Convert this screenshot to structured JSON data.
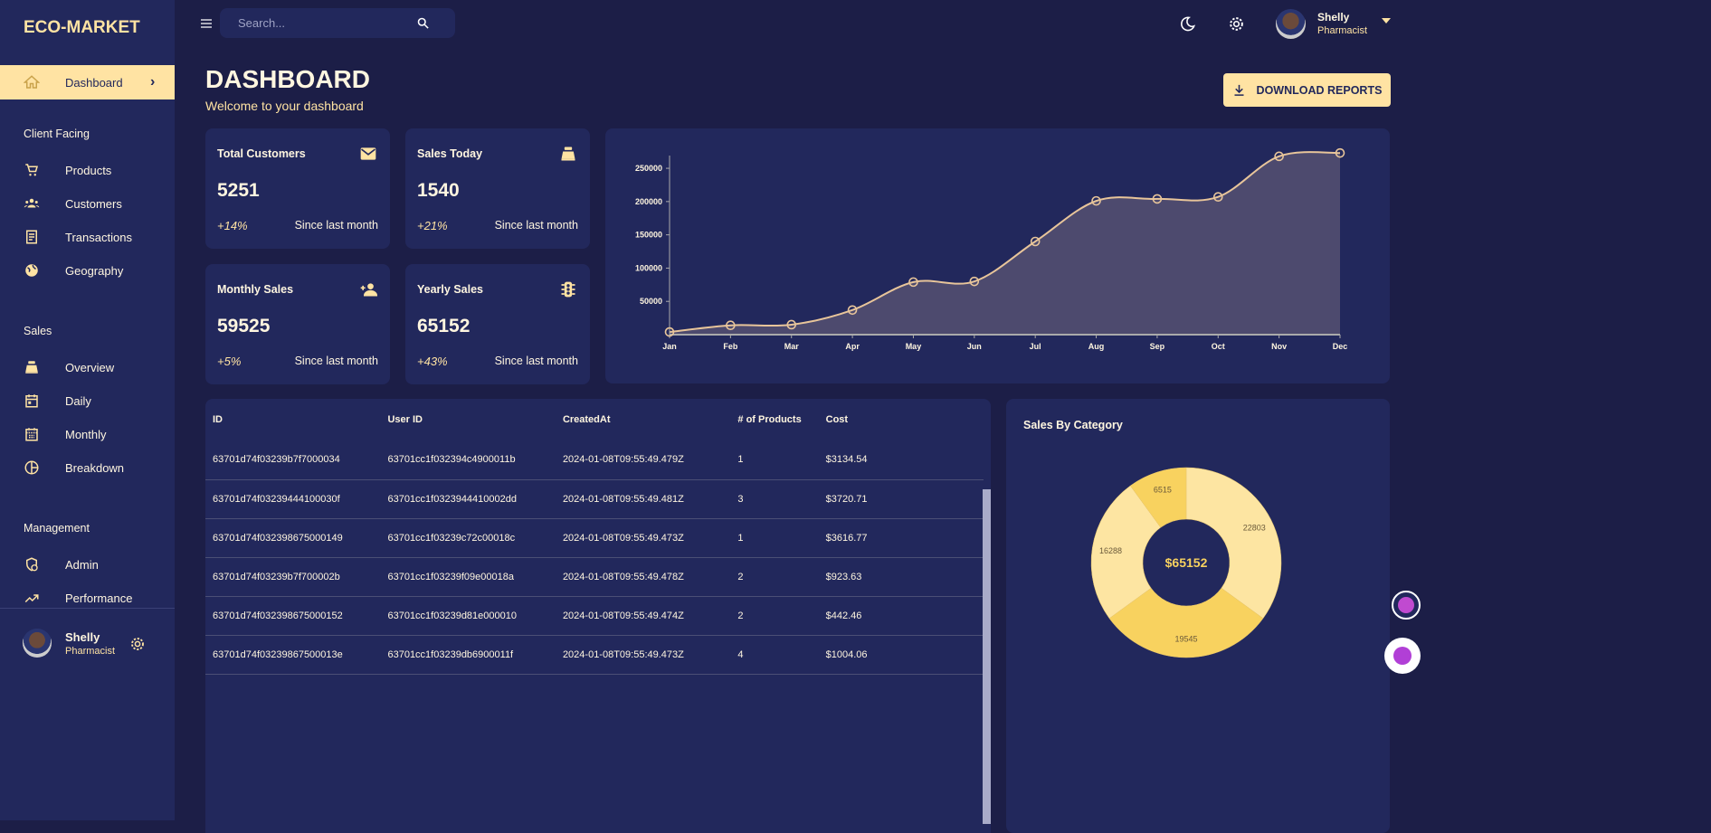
{
  "brand": "ECO-MARKET",
  "sidebar": {
    "active": {
      "label": "Dashboard",
      "icon": "home-icon"
    },
    "sections": [
      {
        "title": "Client Facing",
        "items": [
          {
            "label": "Products",
            "icon": "cart-icon"
          },
          {
            "label": "Customers",
            "icon": "groups-icon"
          },
          {
            "label": "Transactions",
            "icon": "receipt-icon"
          },
          {
            "label": "Geography",
            "icon": "globe-icon"
          }
        ]
      },
      {
        "title": "Sales",
        "items": [
          {
            "label": "Overview",
            "icon": "cash-register-icon"
          },
          {
            "label": "Daily",
            "icon": "calendar-day-icon"
          },
          {
            "label": "Monthly",
            "icon": "calendar-month-icon"
          },
          {
            "label": "Breakdown",
            "icon": "pie-chart-icon"
          }
        ]
      },
      {
        "title": "Management",
        "items": [
          {
            "label": "Admin",
            "icon": "admin-shield-icon"
          },
          {
            "label": "Performance",
            "icon": "trending-up-icon"
          }
        ]
      }
    ],
    "user": {
      "name": "Shelly",
      "role": "Pharmacist"
    }
  },
  "topbar": {
    "search_placeholder": "Search...",
    "user": {
      "name": "Shelly",
      "role": "Pharmacist"
    }
  },
  "header": {
    "title": "DASHBOARD",
    "subtitle": "Welcome to your dashboard",
    "download_label": "DOWNLOAD REPORTS"
  },
  "stats": [
    {
      "title": "Total Customers",
      "value": "5251",
      "change": "+14%",
      "since": "Since last month",
      "icon": "email-icon"
    },
    {
      "title": "Sales Today",
      "value": "1540",
      "change": "+21%",
      "since": "Since last month",
      "icon": "cash-register-icon"
    },
    {
      "title": "Monthly Sales",
      "value": "59525",
      "change": "+5%",
      "since": "Since last month",
      "icon": "person-add-icon"
    },
    {
      "title": "Yearly Sales",
      "value": "65152",
      "change": "+43%",
      "since": "Since last month",
      "icon": "traffic-icon"
    }
  ],
  "table": {
    "columns": [
      "ID",
      "User ID",
      "CreatedAt",
      "# of Products",
      "Cost"
    ],
    "rows": [
      [
        "63701d74f03239b7f7000034",
        "63701cc1f032394c4900011b",
        "2024-01-08T09:55:49.479Z",
        "1",
        "$3134.54"
      ],
      [
        "63701d74f03239444100030f",
        "63701cc1f0323944410002dd",
        "2024-01-08T09:55:49.481Z",
        "3",
        "$3720.71"
      ],
      [
        "63701d74f032398675000149",
        "63701cc1f03239c72c00018c",
        "2024-01-08T09:55:49.473Z",
        "1",
        "$3616.77"
      ],
      [
        "63701d74f03239b7f700002b",
        "63701cc1f03239f09e00018a",
        "2024-01-08T09:55:49.478Z",
        "2",
        "$923.63"
      ],
      [
        "63701d74f032398675000152",
        "63701cc1f03239d81e000010",
        "2024-01-08T09:55:49.474Z",
        "2",
        "$442.46"
      ],
      [
        "63701d74f03239867500013e",
        "63701cc1f03239db6900011f",
        "2024-01-08T09:55:49.473Z",
        "4",
        "$1004.06"
      ]
    ]
  },
  "chart_data": [
    {
      "type": "area",
      "categories": [
        "Jan",
        "Feb",
        "Mar",
        "Apr",
        "May",
        "Jun",
        "Jul",
        "Aug",
        "Sep",
        "Oct",
        "Nov",
        "Dec"
      ],
      "values": [
        4000,
        14000,
        15000,
        37000,
        79000,
        80000,
        140000,
        201000,
        204000,
        207000,
        268000,
        273000
      ],
      "yticks": [
        50000,
        100000,
        150000,
        200000,
        250000
      ],
      "ylim": [
        0,
        280000
      ],
      "grid": false,
      "colors": {
        "line": "#e8c59a",
        "fill": "#4d4a6e"
      }
    },
    {
      "type": "pie",
      "title": "Sales By Category",
      "center_label": "$65152",
      "values": [
        22803,
        19545,
        16288,
        6515
      ],
      "colors": [
        "#fde5a2",
        "#f8d25f",
        "#fde5a2",
        "#f8d25f"
      ]
    }
  ],
  "colors": {
    "accent": "#ffe3a3",
    "sidebar": "#22285c",
    "background": "#1c1e47"
  }
}
